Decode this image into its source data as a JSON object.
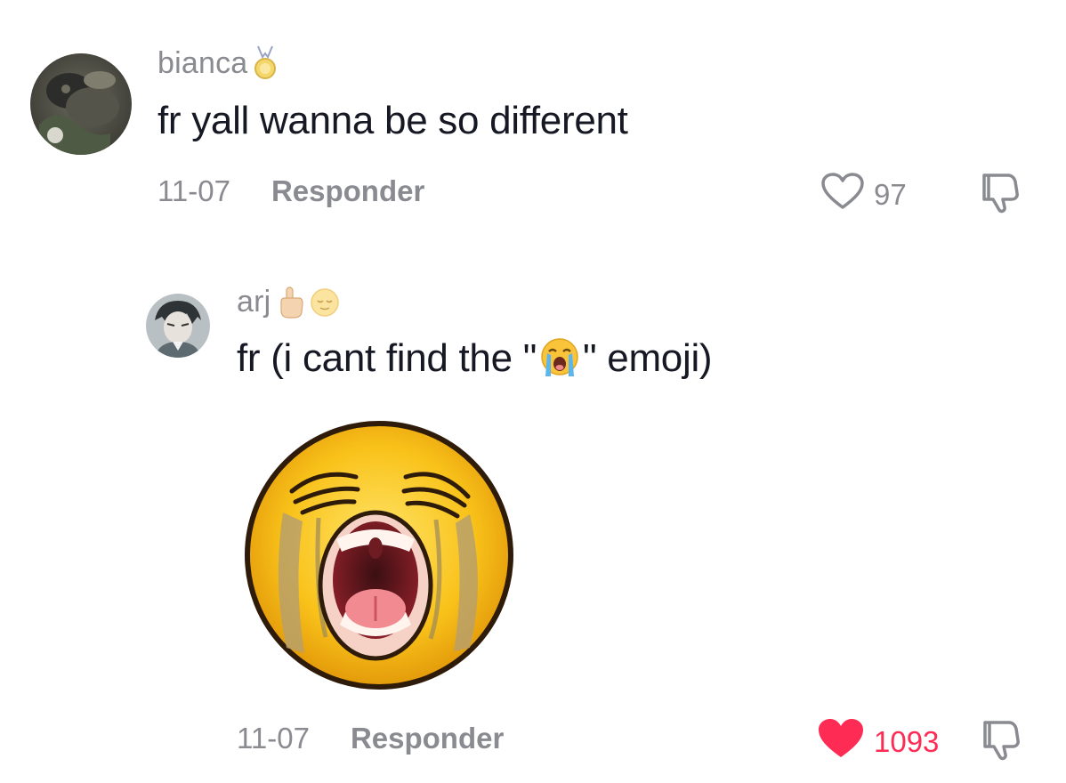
{
  "comments": [
    {
      "username": "bianca",
      "text": "fr yall wanna be so different",
      "date": "11-07",
      "reply_label": "Responder",
      "likes": "97",
      "liked": false,
      "avatar_icon": "profile-photo"
    },
    {
      "username": "arj",
      "text_before": "fr (i cant find the \"",
      "text_emoji_icon": "loudly-crying-face-icon",
      "text_after": "\" emoji)",
      "date": "11-07",
      "reply_label": "Responder",
      "likes": "1093",
      "liked": true,
      "avatar_icon": "profile-photo",
      "sticker_icon": "crying-face-sticker"
    }
  ],
  "colors": {
    "text": "#161823",
    "muted": "#8a8b91",
    "like_active": "#fe2c55",
    "background": "#ffffff"
  }
}
